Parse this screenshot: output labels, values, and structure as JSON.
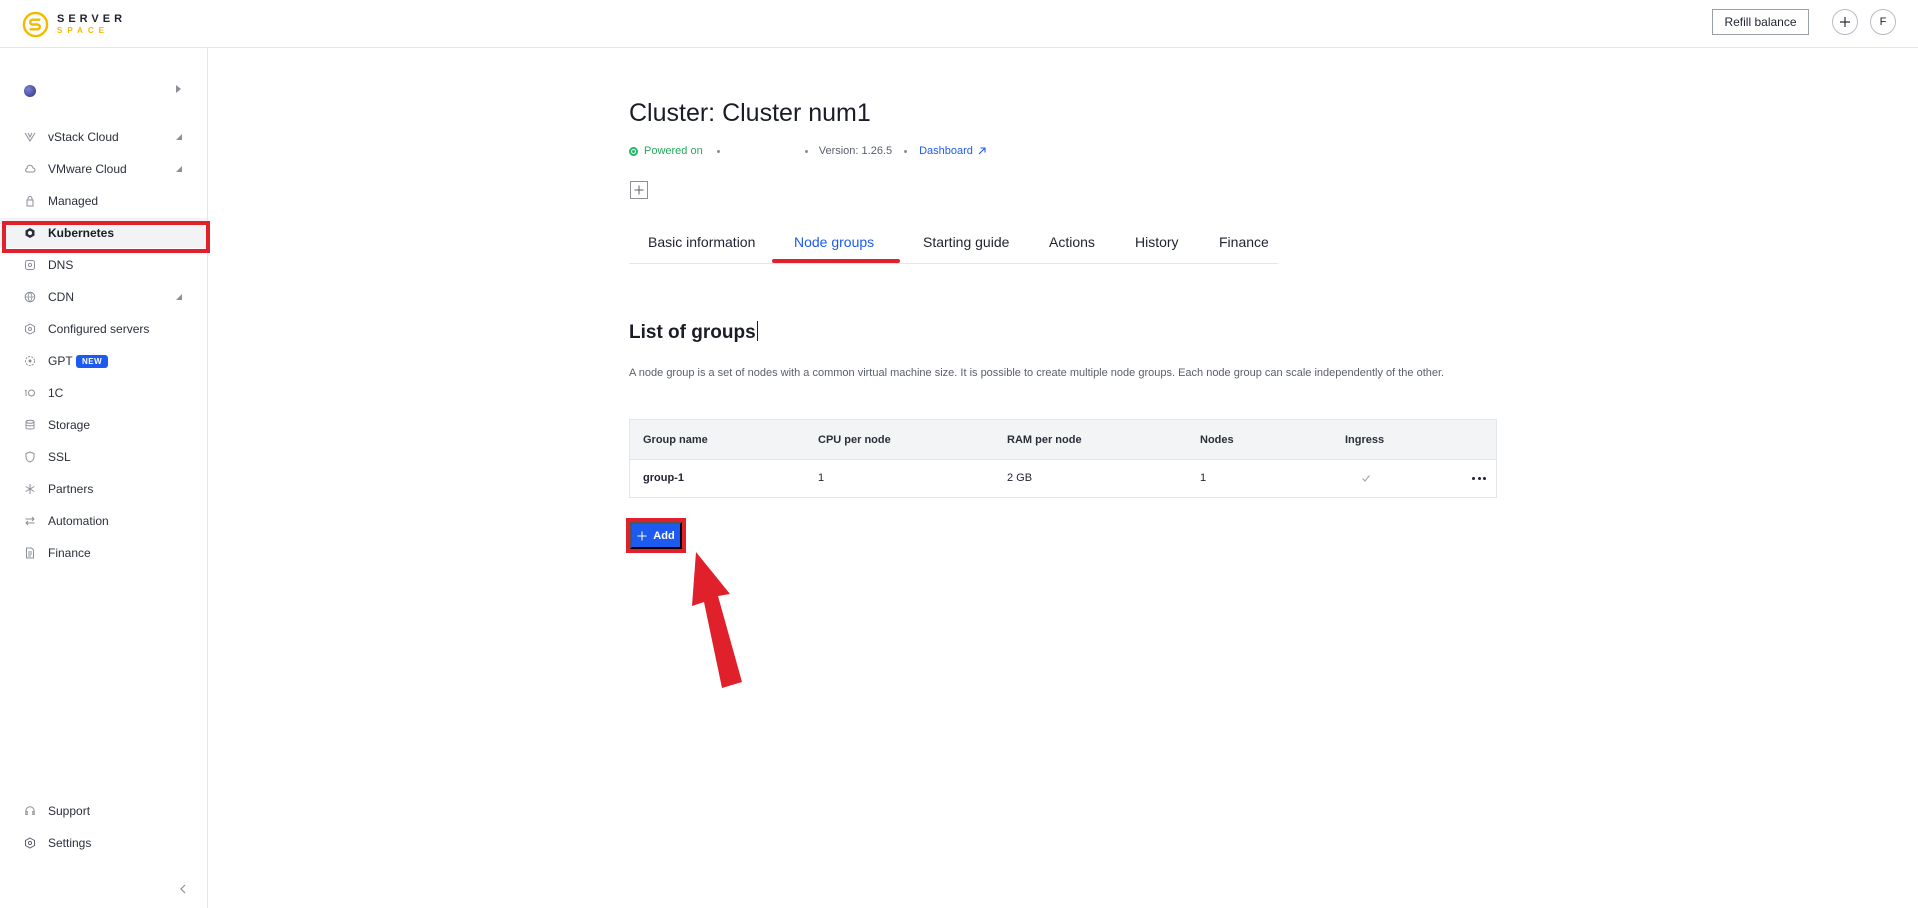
{
  "header": {
    "brand_line1": "SERVER",
    "brand_line2": "SPACE",
    "refill_label": "Refill balance",
    "add_label": "+",
    "avatar_initial": "F"
  },
  "sidebar": {
    "items": [
      {
        "label": "vStack Cloud",
        "icon": "vstack-icon",
        "expandable": true
      },
      {
        "label": "VMware Cloud",
        "icon": "cloud-icon",
        "expandable": true
      },
      {
        "label": "Managed",
        "icon": "managed-icon",
        "expandable": false
      },
      {
        "label": "Kubernetes",
        "icon": "kubernetes-icon",
        "expandable": false,
        "active": true
      },
      {
        "label": "DNS",
        "icon": "dns-icon",
        "expandable": false
      },
      {
        "label": "CDN",
        "icon": "globe-icon",
        "expandable": true
      },
      {
        "label": "Configured servers",
        "icon": "hexagon-icon",
        "expandable": false
      },
      {
        "label": "GPT",
        "icon": "gpt-icon",
        "expandable": false,
        "badge": "NEW"
      },
      {
        "label": "1C",
        "icon": "one-c-icon",
        "expandable": false
      },
      {
        "label": "Storage",
        "icon": "storage-icon",
        "expandable": false
      },
      {
        "label": "SSL",
        "icon": "shield-icon",
        "expandable": false
      },
      {
        "label": "Partners",
        "icon": "partners-icon",
        "expandable": false
      },
      {
        "label": "Automation",
        "icon": "automation-icon",
        "expandable": false
      },
      {
        "label": "Finance",
        "icon": "document-icon",
        "expandable": false
      }
    ],
    "bottom": {
      "support_label": "Support",
      "settings_label": "Settings"
    }
  },
  "main": {
    "title": "Cluster: Cluster num1",
    "status": "Powered on",
    "version": "Version: 1.26.5",
    "dashboard_label": "Dashboard",
    "tabs": [
      {
        "label": "Basic information"
      },
      {
        "label": "Node groups",
        "active": true
      },
      {
        "label": "Starting guide"
      },
      {
        "label": "Actions"
      },
      {
        "label": "History"
      },
      {
        "label": "Finance"
      }
    ],
    "section_title": "List of groups",
    "description": "A node group is a set of nodes with a common virtual machine size. It is possible to create multiple node groups. Each node group can scale independently of the other.",
    "table": {
      "columns": [
        "Group name",
        "CPU per node",
        "RAM per node",
        "Nodes",
        "Ingress"
      ],
      "rows": [
        {
          "group_name": "group-1",
          "cpu": "1",
          "ram": "2 GB",
          "nodes": "1",
          "ingress": true
        }
      ]
    },
    "add_label": "Add"
  },
  "colors": {
    "accent": "#1d5bf0",
    "highlight": "#e0202a",
    "status_green": "#29a660",
    "brand_yellow": "#f5b800"
  }
}
